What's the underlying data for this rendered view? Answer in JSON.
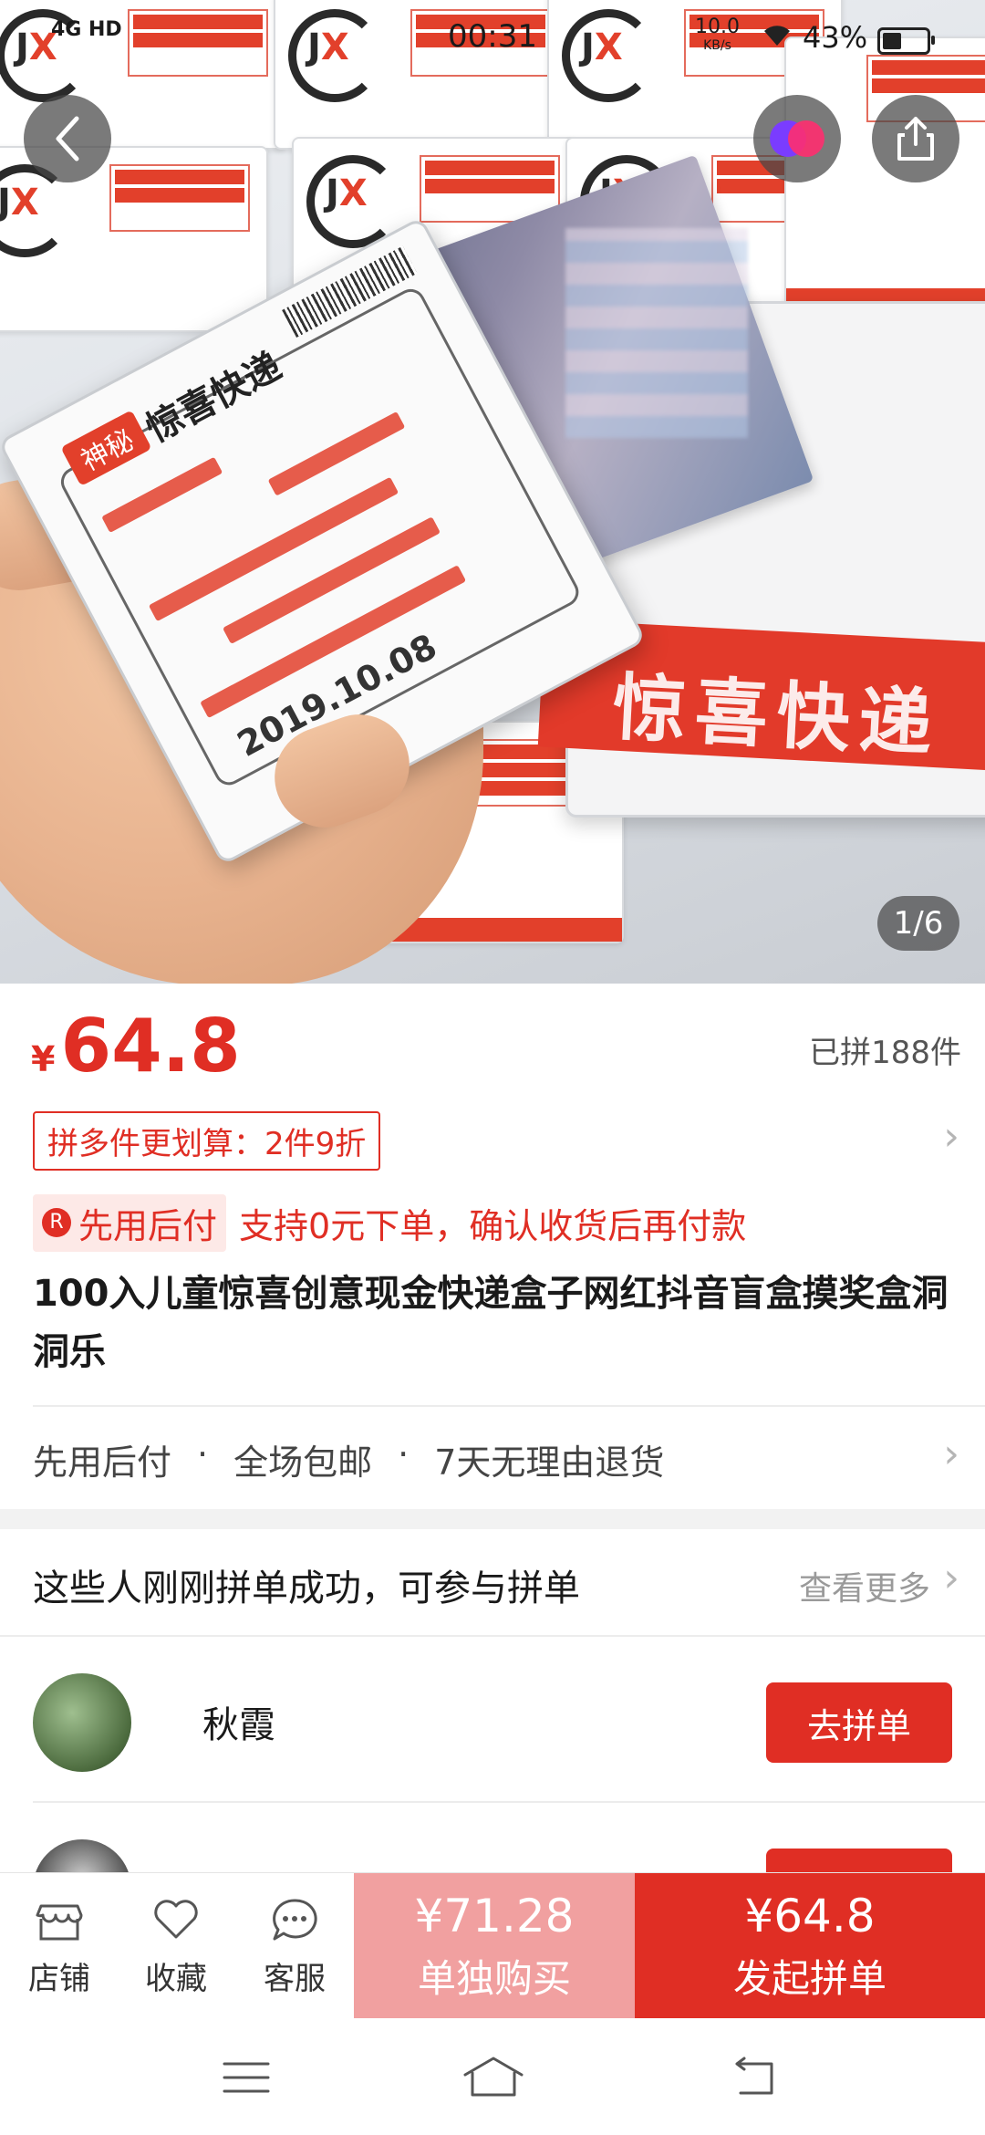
{
  "status_bar": {
    "network": "4G HD",
    "time": "00:31",
    "speed_value": "10.0",
    "speed_unit": "KB/s",
    "battery_pct": "43%"
  },
  "gallery": {
    "counter": "1/6",
    "card_tag": "神秘",
    "card_title": "惊喜快递",
    "card_date": "2019.10.08",
    "box_band": "惊喜快递"
  },
  "product": {
    "currency": "¥",
    "price": "64.8",
    "sold": "已拼188件",
    "promo": "拼多件更划算：2件9折",
    "pay_later_tag": "先用后付",
    "pay_later_icon": "R",
    "pay_later_desc": "支持0元下单，确认收货后再付款",
    "title": "100入儿童惊喜创意现金快递盒子网红抖音盲盒摸奖盒洞洞乐"
  },
  "services": [
    "先用后付",
    "·",
    "全场包邮",
    "·",
    "7天无理由退货"
  ],
  "group_buy": {
    "heading": "这些人刚刚拼单成功，可参与拼单",
    "more": "查看更多",
    "members": [
      {
        "name": "秋霞",
        "button": "去拼单"
      },
      {
        "name": "",
        "button": "去拼单"
      }
    ]
  },
  "action_bar": {
    "shop": "店铺",
    "favorite": "收藏",
    "service": "客服",
    "alone_price": "¥71.28",
    "alone_label": "单独购买",
    "group_price": "¥64.8",
    "group_label": "发起拼单"
  },
  "colors": {
    "accent": "#e02e24",
    "accent_light": "#f1a0a0"
  }
}
